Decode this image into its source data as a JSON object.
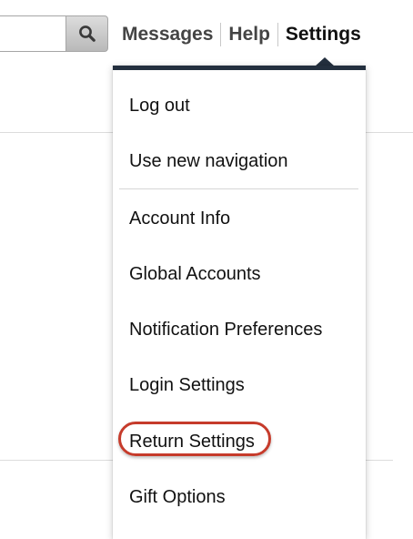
{
  "header": {
    "search": {
      "value": "",
      "placeholder": "",
      "button_icon": "search-icon"
    },
    "nav": [
      {
        "label": "Messages"
      },
      {
        "label": "Help"
      },
      {
        "label": "Settings"
      }
    ]
  },
  "settings_menu": {
    "items": [
      {
        "label": "Log out"
      },
      {
        "label": "Use new navigation"
      },
      {
        "label": "Account Info"
      },
      {
        "label": "Global Accounts"
      },
      {
        "label": "Notification Preferences"
      },
      {
        "label": "Login Settings"
      },
      {
        "label": "Return Settings"
      },
      {
        "label": "Gift Options"
      }
    ],
    "highlighted_item": "Return Settings"
  },
  "colors": {
    "dropdown_accent": "#232f3e",
    "highlight_ring": "#c63b2b"
  }
}
